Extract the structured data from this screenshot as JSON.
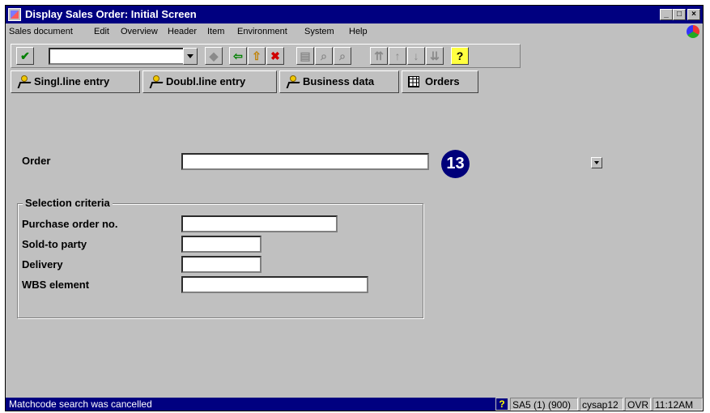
{
  "window": {
    "title": "Display Sales Order: Initial Screen",
    "controls": {
      "minimize": "_",
      "maximize": "□",
      "close": "×"
    }
  },
  "menubar": {
    "items": [
      "Sales document",
      "Edit",
      "Overview",
      "Header",
      "Item",
      "Environment",
      "System",
      "Help"
    ]
  },
  "toolbar": {
    "command_field_value": "",
    "icons": [
      "enter-icon",
      "save-icon",
      "back-icon",
      "exit-icon",
      "cancel-icon",
      "print-icon",
      "find-icon",
      "find-next-icon",
      "first-page-icon",
      "previous-page-icon",
      "next-page-icon",
      "last-page-icon",
      "help-icon"
    ],
    "help_label": "?"
  },
  "app_toolbar": {
    "buttons": [
      {
        "label": "Singl.line entry",
        "icon": "person-icon"
      },
      {
        "label": "Doubl.line entry",
        "icon": "person-icon"
      },
      {
        "label": "Business data",
        "icon": "person-icon"
      },
      {
        "label": "Orders",
        "icon": "table-icon"
      }
    ]
  },
  "form": {
    "order_label": "Order",
    "order_value": "",
    "callout_number": "13",
    "selection_group_title": "Selection criteria",
    "fields": [
      {
        "label": "Purchase order no.",
        "value": ""
      },
      {
        "label": "Sold-to party",
        "value": ""
      },
      {
        "label": "Delivery",
        "value": ""
      },
      {
        "label": "WBS element",
        "value": ""
      }
    ]
  },
  "statusbar": {
    "message": "Matchcode search was cancelled",
    "help_icon": "?",
    "system": "SA5 (1) (900)",
    "server": "cysap12",
    "mode": "OVR",
    "time": "11:12AM"
  },
  "colors": {
    "titlebar": "#000080",
    "window_bg": "#c0c0c0",
    "badge": "#00007a",
    "statusbar_msg": "#000080"
  }
}
